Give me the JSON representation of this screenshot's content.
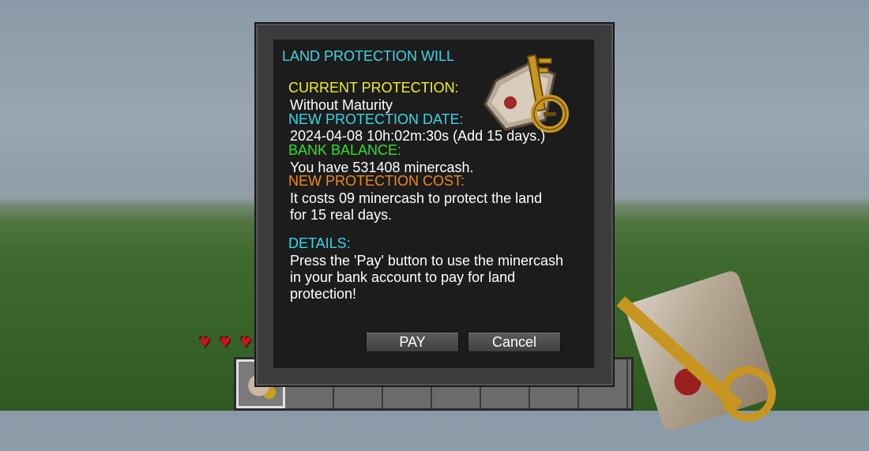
{
  "dialog": {
    "title": "LAND PROTECTION WILL",
    "current_protection_label": "CURRENT PROTECTION:",
    "current_protection_value": "Without Maturity",
    "new_date_label": "NEW PROTECTION DATE:",
    "new_date_value": "2024-04-08 10h:02m:30s (Add 15 days.)",
    "bank_balance_label": "BANK BALANCE:",
    "bank_balance_value": "You have 531408 minercash.",
    "cost_label": "NEW PROTECTION COST:",
    "cost_value_line1": "It costs 09 minercash to protect the land",
    "cost_value_line2": "for 15 real days.",
    "details_label": "DETAILS:",
    "details_line1": "Press the 'Pay' button to use the minercash",
    "details_line2": "in your bank account to pay for land",
    "details_line3": "protection!",
    "pay_button": "PAY",
    "cancel_button": "Cancel",
    "icon": "land-will-scroll-key-icon"
  },
  "hud": {
    "hearts_visible": 3,
    "hotbar_selected_slot": 1,
    "held_item_icon": "land-will-scroll-key-icon"
  },
  "colors": {
    "title": "#3ad6e6",
    "yellow_label": "#f2ee2a",
    "cyan_label": "#3ad6e6",
    "green_label": "#2fe02a",
    "orange_label": "#ee8a1c",
    "panel_bg": "#1c1c1c"
  }
}
